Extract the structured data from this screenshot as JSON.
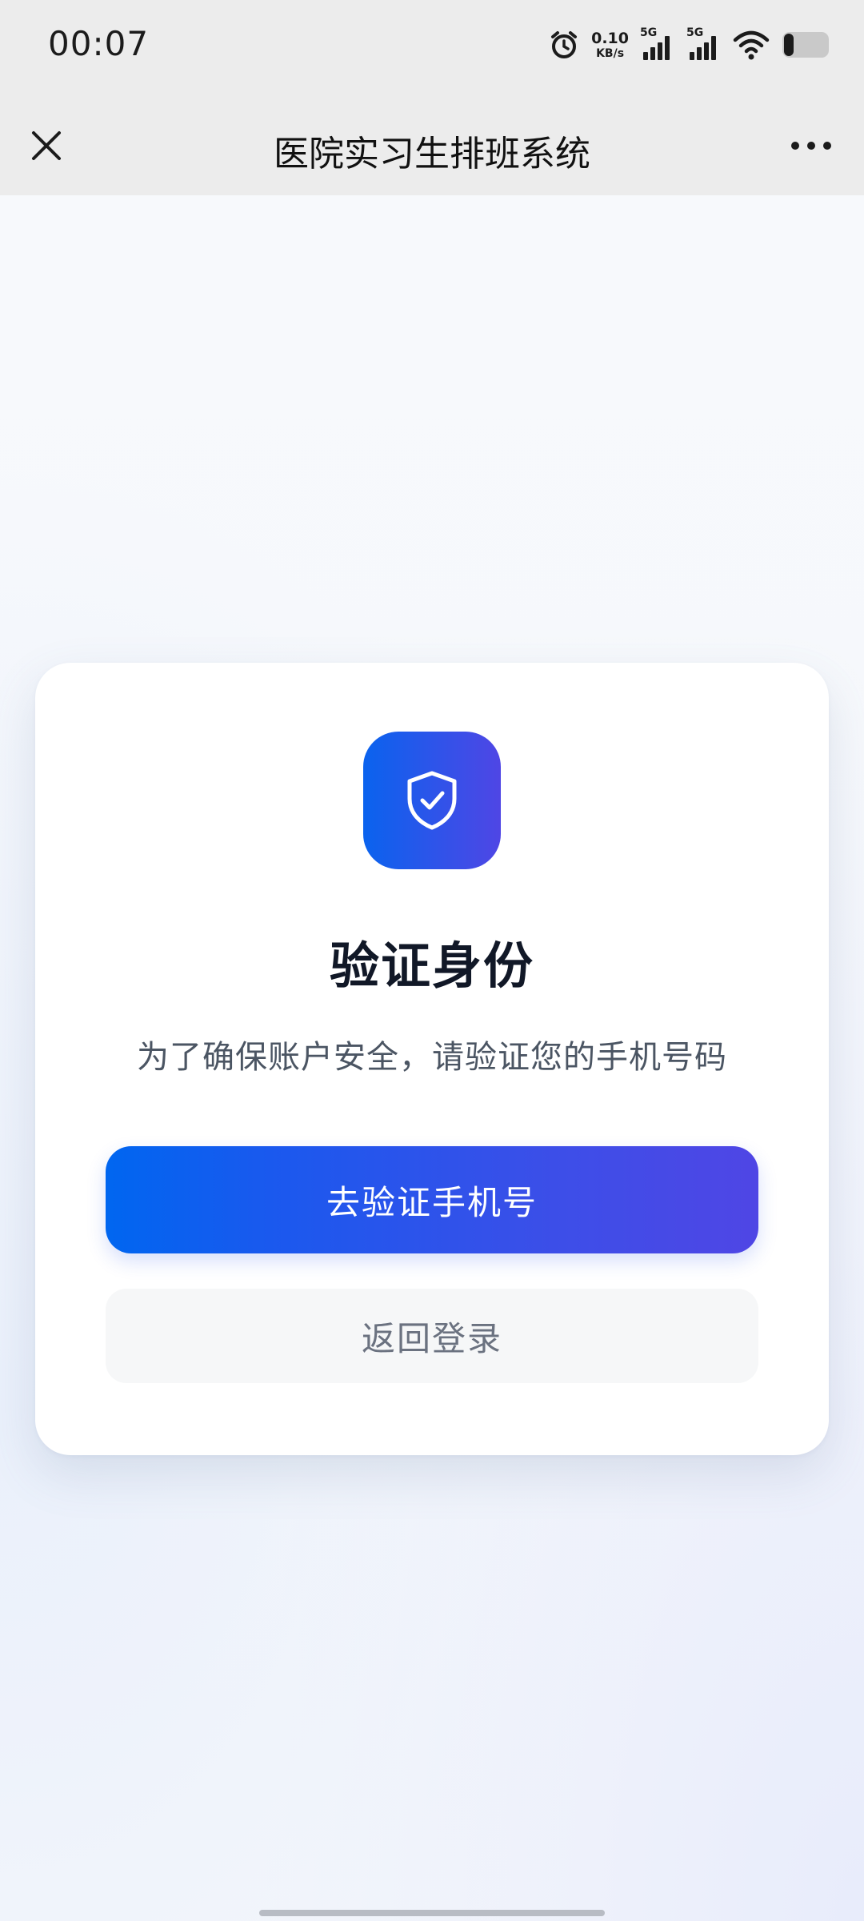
{
  "status_bar": {
    "time": "00:07",
    "net_speed_value": "0.10",
    "net_speed_unit": "KB/s",
    "sim1_label": "5G",
    "sim2_label": "5G",
    "icons": [
      "alarm-icon",
      "signal-icon",
      "signal-icon",
      "wifi-icon",
      "battery-icon"
    ]
  },
  "nav": {
    "title": "医院实习生排班系统",
    "close_icon": "close-icon",
    "more_icon": "more-icon"
  },
  "card": {
    "icon": "shield-check-icon",
    "title": "验证身份",
    "subtitle": "为了确保账户安全，请验证您的手机号码",
    "primary_button": "去验证手机号",
    "secondary_button": "返回登录"
  },
  "colors": {
    "accent_start": "#0a63ee",
    "accent_end": "#4f46e5",
    "title_text": "#111827",
    "sub_text": "#4b5563"
  }
}
